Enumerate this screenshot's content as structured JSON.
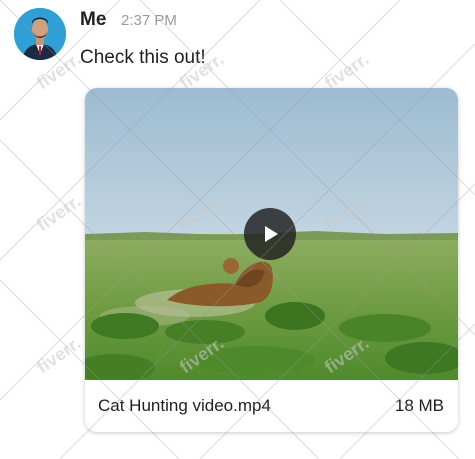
{
  "message": {
    "sender": "Me",
    "time": "2:37 PM",
    "text": "Check this out!",
    "avatar_icon": "user-avatar"
  },
  "attachment": {
    "file_name": "Cat Hunting video.mp4",
    "file_size": "18 MB",
    "play_icon": "play-icon"
  },
  "watermark": {
    "text": "fiverr."
  },
  "colors": {
    "avatar_bg": "#2f9fd6",
    "sky": "#a9c6db",
    "grass": "#6c9e3f",
    "play_bg": "#1e1e1e"
  }
}
